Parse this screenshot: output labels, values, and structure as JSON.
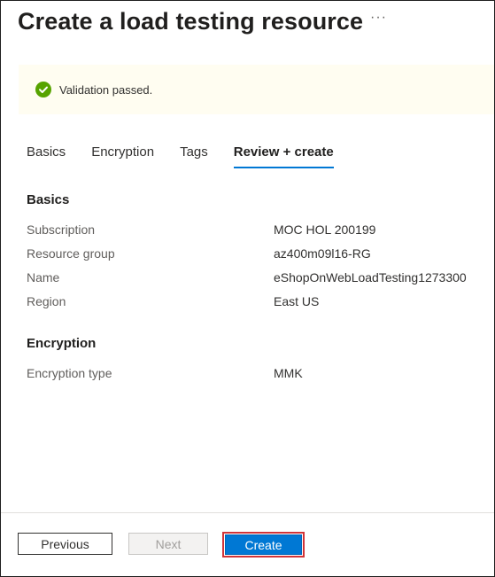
{
  "page": {
    "title": "Create a load testing resource",
    "more_label": "···"
  },
  "banner": {
    "icon": "check-circle-icon",
    "text": "Validation passed.",
    "color": "#57a300"
  },
  "tabs": [
    {
      "label": "Basics"
    },
    {
      "label": "Encryption"
    },
    {
      "label": "Tags"
    },
    {
      "label": "Review + create",
      "active": true
    }
  ],
  "basics": {
    "heading": "Basics",
    "rows": [
      {
        "label": "Subscription",
        "value": "MOC HOL 200199"
      },
      {
        "label": "Resource group",
        "value": "az400m09l16-RG"
      },
      {
        "label": "Name",
        "value": "eShopOnWebLoadTesting1273300"
      },
      {
        "label": "Region",
        "value": "East US"
      }
    ]
  },
  "encryption": {
    "heading": "Encryption",
    "rows": [
      {
        "label": "Encryption type",
        "value": "MMK"
      }
    ]
  },
  "footer": {
    "previous_label": "Previous",
    "next_label": "Next",
    "create_label": "Create"
  },
  "colors": {
    "accent": "#0078d4",
    "highlight": "#d13438"
  }
}
